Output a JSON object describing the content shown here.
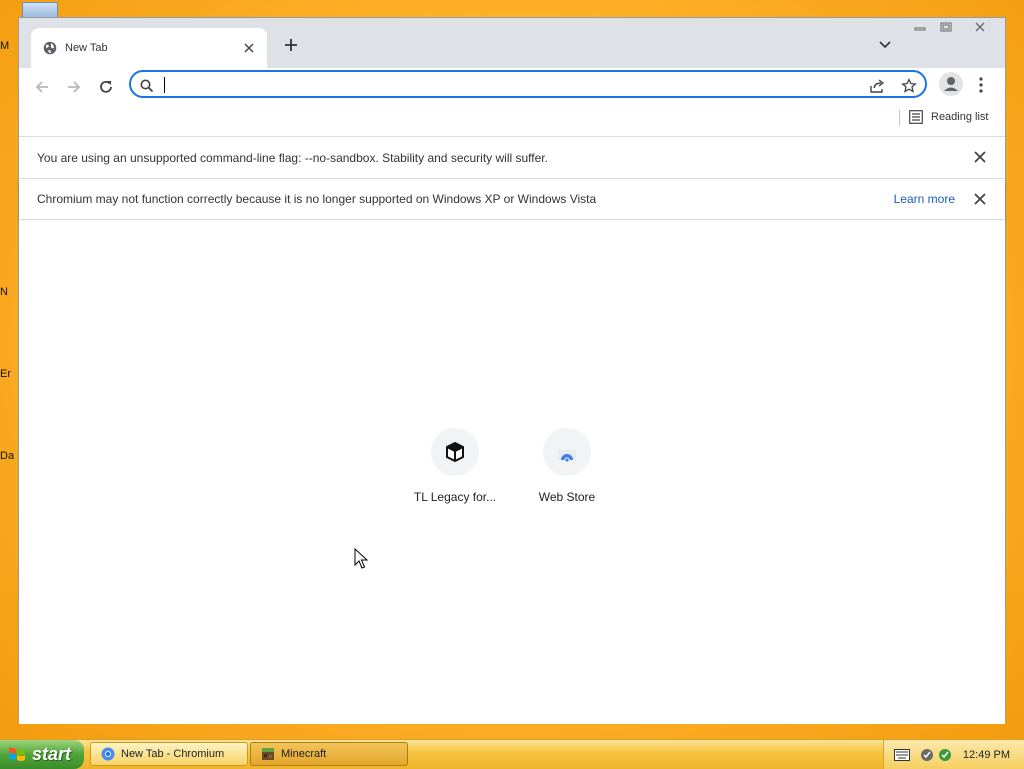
{
  "desktop": {
    "labels": [
      "M",
      "N",
      "Er",
      "Da"
    ]
  },
  "browser": {
    "tab_title": "New Tab",
    "omnibox_value": "",
    "reading_list_label": "Reading list",
    "infobars": [
      {
        "text": "You are using an unsupported command-line flag: --no-sandbox. Stability and security will suffer."
      },
      {
        "text": "Chromium may not function correctly because it is no longer supported on Windows XP or Windows Vista",
        "link": "Learn more"
      }
    ],
    "shortcuts": [
      {
        "label": "TL Legacy for...",
        "icon": "cube-icon"
      },
      {
        "label": "Web Store",
        "icon": "web-store-icon"
      }
    ]
  },
  "taskbar": {
    "start_label": "start",
    "tasks": [
      {
        "label": "New Tab - Chromium",
        "icon": "chromium-icon",
        "active": false
      },
      {
        "label": "Minecraft",
        "icon": "minecraft-icon",
        "active": true
      }
    ],
    "clock": "12:49 PM"
  },
  "colors": {
    "accent": "#1a73e8",
    "desktop": "#f39a0d",
    "taskbar": "#f6c542",
    "start": "#4fa53a"
  }
}
